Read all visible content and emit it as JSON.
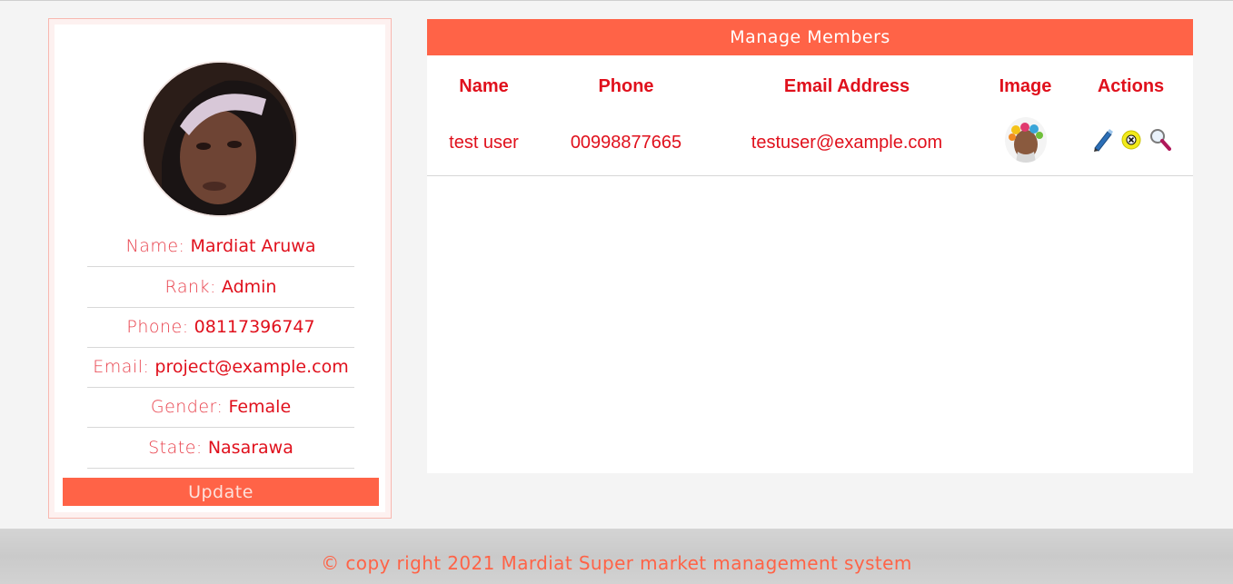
{
  "profile": {
    "avatar_icon": "user-photo",
    "rows": [
      {
        "label": "Name:",
        "value": "Mardiat Aruwa"
      },
      {
        "label": "Rank:",
        "value": "Admin"
      },
      {
        "label": "Phone:",
        "value": "08117396747"
      },
      {
        "label": "Email:",
        "value": "project@example.com"
      },
      {
        "label": "Gender:",
        "value": "Female"
      },
      {
        "label": "State:",
        "value": "Nasarawa"
      }
    ],
    "update_label": "Update"
  },
  "members": {
    "title": "Manage Members",
    "columns": [
      "Name",
      "Phone",
      "Email Address",
      "Image",
      "Actions"
    ],
    "rows": [
      {
        "name": "test user",
        "phone": "00998877665",
        "email": "testuser@example.com",
        "image_icon": "member-photo",
        "actions": [
          "edit-icon",
          "delete-icon",
          "view-icon"
        ]
      }
    ]
  },
  "footer": {
    "text": "© copy right 2021 Mardiat Super market management system"
  },
  "colors": {
    "accent": "#ff6347",
    "text_red": "#e0101c",
    "background": "#f4f4f4"
  }
}
